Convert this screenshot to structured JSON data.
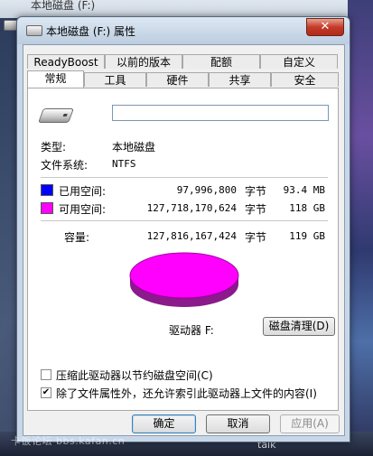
{
  "background": {
    "window_title": "本地磁盘 (F:)",
    "taskbar_text": "talk",
    "watermark": "卡饭论坛 bbs.kafan.cn"
  },
  "dialog": {
    "title": "本地磁盘 (F:) 属性",
    "close_glyph": "✕",
    "tabs_row1": [
      "ReadyBoost",
      "以前的版本",
      "配额",
      "自定义"
    ],
    "tabs_row2": [
      "常规",
      "工具",
      "硬件",
      "共享",
      "安全"
    ],
    "active_tab": "常规"
  },
  "general": {
    "volume_name": "",
    "type_label": "类型:",
    "type_value": "本地磁盘",
    "fs_label": "文件系统:",
    "fs_value": "NTFS",
    "used": {
      "label": "已用空间:",
      "bytes": "97,996,800",
      "unit": "字节",
      "size": "93.4 MB",
      "color": "#0000ff"
    },
    "free": {
      "label": "可用空间:",
      "bytes": "127,718,170,624",
      "unit": "字节",
      "size": "118 GB",
      "color": "#ff00ff"
    },
    "capacity": {
      "label": "容量:",
      "bytes": "127,816,167,424",
      "unit": "字节",
      "size": "119 GB"
    },
    "drive_label": "驱动器 F:",
    "cleanup_button": "磁盘清理(D)",
    "compress_label": "压缩此驱动器以节约磁盘空间(C)",
    "compress_checked": false,
    "index_label": "除了文件属性外，还允许索引此驱动器上文件的内容(I)",
    "index_checked": true
  },
  "buttons": {
    "ok": "确定",
    "cancel": "取消",
    "apply": "应用(A)"
  },
  "icons": {
    "drive": "drive-icon",
    "close": "close-icon",
    "check": "✔"
  }
}
